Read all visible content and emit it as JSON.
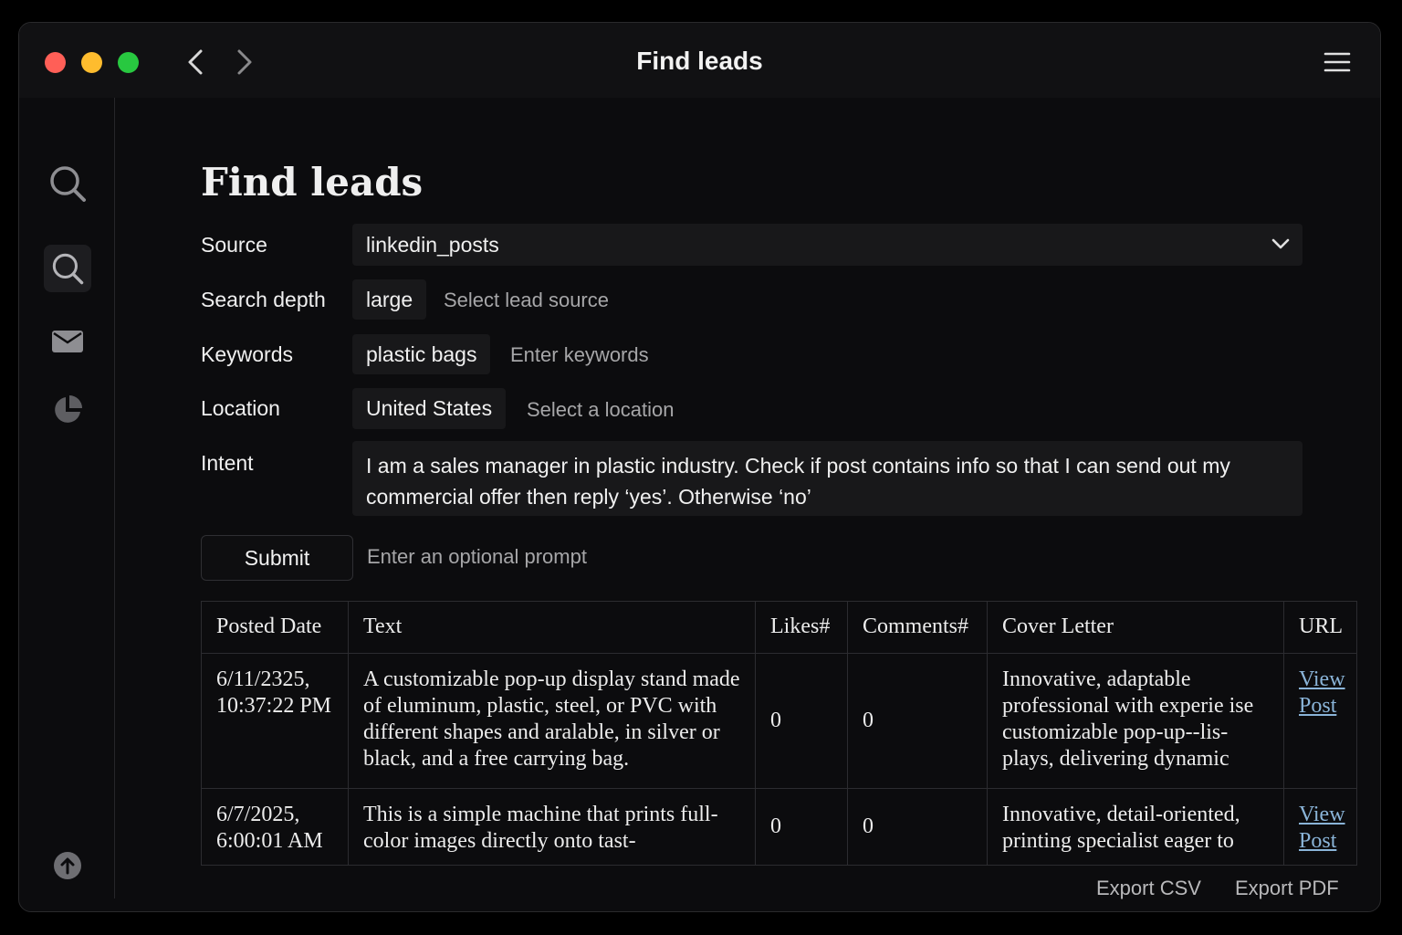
{
  "window": {
    "title": "Find leads"
  },
  "page": {
    "title": "Find leads"
  },
  "form": {
    "source": {
      "label": "Source",
      "value": "linkedin_posts"
    },
    "search_depth": {
      "label": "Search depth",
      "value": "large",
      "placeholder": "Select lead source"
    },
    "keywords": {
      "label": "Keywords",
      "value": "plastic bags",
      "placeholder": "Enter keywords"
    },
    "location": {
      "label": "Location",
      "value": "United States",
      "placeholder": "Select a location"
    },
    "intent": {
      "label": "Intent",
      "value": "I am a sales manager in plastic industry. Check if post contains info so that I can send out my commercial offer then reply ‘yes’. Otherwise ‘no’"
    },
    "submit_label": "Submit",
    "prompt_placeholder": "Enter an optional prompt"
  },
  "table": {
    "columns": [
      "Posted Date",
      "Text",
      "Likes#",
      "Comments#",
      "Cover Letter",
      "URL"
    ],
    "rows": [
      {
        "date": "6/11/2325, 10:37:22 PM",
        "text": "A customizable pop-up display stand made of eluminum, plastic, steel, or PVC with different shapes and aralable, in silver or black, and a free carrying bag.",
        "likes": "0",
        "comments": "0",
        "cover_letter": "Innovative, adaptable professional with experie ise customizable pop-up--lis- plays, delivering dynamic",
        "url_label": "View Post"
      },
      {
        "date": "6/7/2025, 6:00:01 AM",
        "text": "This is a simple machine that prints full-color images directly onto tast-",
        "likes": "0",
        "comments": "0",
        "cover_letter": "Innovative, detail-oriented, printing specialist eager to",
        "url_label": "View Post"
      }
    ]
  },
  "exports": {
    "csv": "Export CSV",
    "pdf": "Export PDF"
  },
  "icons": {
    "sidebar": [
      "search-icon",
      "search-icon",
      "mail-icon",
      "pie-chart-icon",
      "upload-icon"
    ],
    "titlebar": [
      "back-arrow-icon",
      "forward-arrow-icon",
      "menu-icon",
      "chevron-down-icon"
    ]
  },
  "colors": {
    "close": "#ff5f57",
    "minimize": "#febc2e",
    "maximize": "#28c840",
    "link": "#8ab4d8"
  }
}
